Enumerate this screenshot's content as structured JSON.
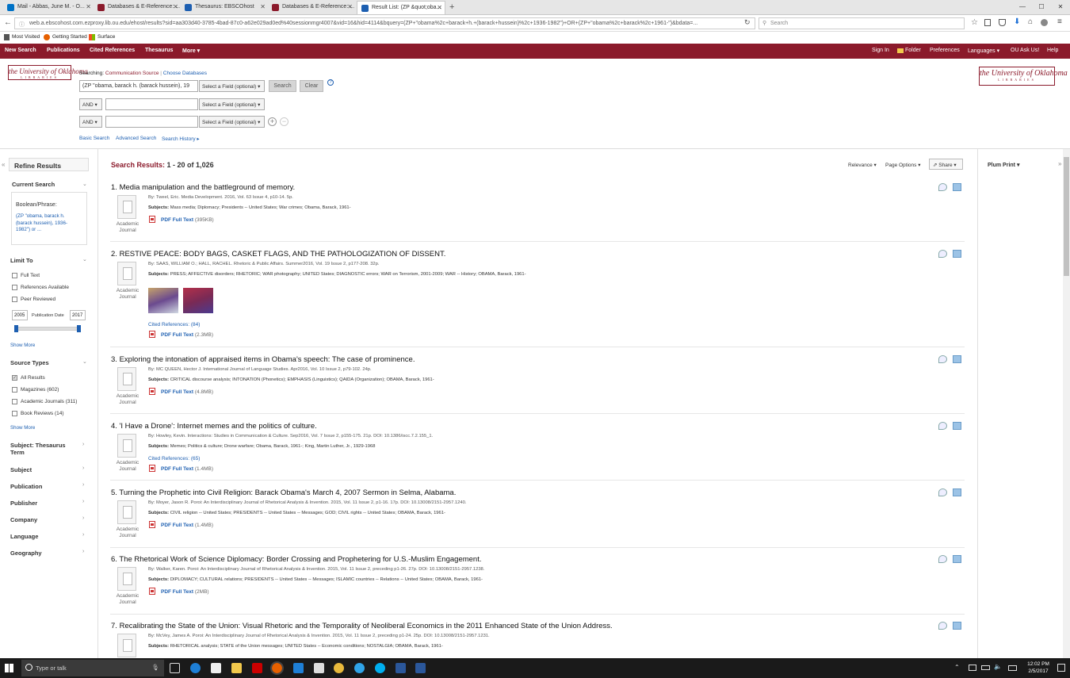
{
  "browser": {
    "tabs": [
      {
        "label": "Mail - Abbas, June M. - O...",
        "color": "#0072c6"
      },
      {
        "label": "Databases & E-Reference: ...",
        "color": "#8b1a2b"
      },
      {
        "label": "Thesaurus: EBSCOhost",
        "color": "#1d5fb1"
      },
      {
        "label": "Databases & E-Reference: ...",
        "color": "#8b1a2b"
      },
      {
        "label": "Result List: (ZP &quot;oba...",
        "color": "#1d5fb1"
      }
    ],
    "new_tab": "+",
    "url": "web.a.ebscohost.com.ezproxy.lib.ou.edu/ehost/results?sid=aa303d40-3785-4bad-87c0-a62e029ad0ed%40sessionmgr4007&vid=16&hid=4114&bquery=(ZP+\"obama%2c+barack+h.+(barack+hussein)%2c+1936-1982\")+OR+(ZP+\"obama%2c+barack%2c+1961-\")&bdata=...",
    "search_placeholder": "Search",
    "bookmarks": [
      "Most Visited",
      "Getting Started",
      "Surface"
    ]
  },
  "topnav": {
    "left": [
      "New Search",
      "Publications",
      "Cited References",
      "Thesaurus",
      "More ▾"
    ],
    "right": [
      "Sign In",
      "Folder",
      "Preferences",
      "Languages ▾",
      "OU Ask Us!",
      "Help"
    ]
  },
  "search": {
    "searching_label": "Searching:",
    "database": "Communication Source",
    "choose_db": "Choose Databases",
    "query1": "(ZP \"obama, barack h. (barack hussein), 19",
    "field_placeholder": "Select a Field (optional) ▾",
    "search_btn": "Search",
    "clear_btn": "Clear",
    "bool": "AND ▾",
    "links": [
      "Basic Search",
      "Advanced Search",
      "Search History ▸"
    ]
  },
  "logo": {
    "title": "the University of Oklahoma",
    "sub": "LIBRARIES"
  },
  "sidebar": {
    "refine": "Refine Results",
    "current_search": "Current Search",
    "boolean_label": "Boolean/Phrase:",
    "boolean_value": "(ZP \"obama, barack h. (barack hussein), 1936-1982\") or ...",
    "limit_to": "Limit To",
    "limits": [
      "Full Text",
      "References Available",
      "Peer Reviewed"
    ],
    "date_from": "2005",
    "date_label": "Publication Date",
    "date_to": "2017",
    "show_more": "Show More",
    "source_types": "Source Types",
    "sources": [
      "All Results",
      "Magazines (602)",
      "Academic Journals (311)",
      "Book Reviews (14)"
    ],
    "facets": [
      "Subject: Thesaurus Term",
      "Subject",
      "Publication",
      "Publisher",
      "Company",
      "Language",
      "Geography"
    ]
  },
  "results_header": {
    "label": "Search Results:",
    "range": "1 - 20 of 1,026",
    "relevance": "Relevance ▾",
    "page_options": "Page Options ▾",
    "share": "Share ▾"
  },
  "right": {
    "plum": "Plum Print ▾"
  },
  "results": [
    {
      "num": "1.",
      "title": "Media manipulation and the battleground of memory.",
      "meta": "By: Tweel, Eric. Media Development. 2016, Vol. 63 Issue 4, p10-14. 5p.",
      "subjects": "Mass media; Diplomacy; Presidents -- United States; War crimes; Obama, Barack, 1961-",
      "type": "Academic Journal",
      "cited": "",
      "pdf": "PDF Full Text",
      "size": "(395KB)",
      "images": false
    },
    {
      "num": "2.",
      "title": "RESTIVE PEACE: BODY BAGS, CASKET FLAGS, AND THE PATHOLOGIZATION OF DISSENT.",
      "meta": "By: SAAS, WILLIAM O.; HALL, RACHEL. Rhetoric & Public Affairs. Summer2016, Vol. 19 Issue 2, p177-208. 32p.",
      "subjects": "PRESS; AFFECTIVE disorders; RHETORIC; WAR photography; UNITED States; DIAGNOSTIC errors; WAR on Terrorism, 2001-2009; WAR -- History; OBAMA, Barack, 1961-",
      "type": "Academic Journal",
      "cited": "Cited References: (84)",
      "pdf": "PDF Full Text",
      "size": "(2.3MB)",
      "images": true
    },
    {
      "num": "3.",
      "title": "Exploring the intonation of appraised items in Obama's speech: The case of prominence.",
      "meta": "By: MC QUEEN, Hector J. International Journal of Language Studies. Apr2016, Vol. 10 Issue 2, p79-102. 24p.",
      "subjects": "CRITICAL discourse analysis; INTONATION (Phonetics); EMPHASIS (Linguistics); QAIDA (Organization); OBAMA, Barack, 1961-",
      "type": "Academic Journal",
      "cited": "",
      "pdf": "PDF Full Text",
      "size": "(4.8MB)",
      "images": false
    },
    {
      "num": "4.",
      "title": "'I Have a Drone': Internet memes and the politics of culture.",
      "meta": "By: Howley, Kevin. Interactions: Studies in Communication & Culture. Sep2016, Vol. 7 Issue 2, p155-175. 21p. DOI: 10.1386/iscc.7.2.155_1.",
      "subjects": "Memes; Politics & culture; Drone warfare; Obama, Barack, 1961-; King, Martin Luther, Jr., 1929-1968",
      "type": "Academic Journal",
      "cited": "Cited References: (65)",
      "pdf": "PDF Full Text",
      "size": "(1.4MB)",
      "images": false
    },
    {
      "num": "5.",
      "title": "Turning the Prophetic into Civil Religion: Barack Obama's March 4, 2007 Sermon in Selma, Alabama.",
      "meta": "By: Moyer, Jason R. Poroi: An Interdisciplinary Journal of Rhetorical Analysis & Invention. 2015, Vol. 11 Issue 2, p1-16. 17p. DOI: 10.13008/2151-2957.1240.",
      "subjects": "CIVIL religion -- United States; PRESIDENTS -- United States -- Messages; GOD; CIVIL rights -- United States; OBAMA, Barack, 1961-",
      "type": "Academic Journal",
      "cited": "",
      "pdf": "PDF Full Text",
      "size": "(1.4MB)",
      "images": false
    },
    {
      "num": "6.",
      "title": "The Rhetorical Work of Science Diplomacy: Border Crossing and Prophetering for U.S.-Muslim Engagement.",
      "meta": "By: Walker, Karen. Poroi: An Interdisciplinary Journal of Rhetorical Analysis & Invention. 2015, Vol. 11 Issue 2, preceding p1-26. 27p. DOI: 10.13008/2151-2957.1238.",
      "subjects": "DIPLOMACY; CULTURAL relations; PRESIDENTS -- United States -- Messages; ISLAMIC countries -- Relations -- United States; OBAMA, Barack, 1961-",
      "type": "Academic Journal",
      "cited": "",
      "pdf": "PDF Full Text",
      "size": "(2MB)",
      "images": false
    },
    {
      "num": "7.",
      "title": "Recalibrating the State of the Union: Visual Rhetoric and the Temporality of Neoliberal Economics in the 2011 Enhanced State of the Union Address.",
      "meta": "By: McVey, James A. Poroi: An Interdisciplinary Journal of Rhetorical Analysis & Invention. 2015, Vol. 11 Issue 2, preceding p1-24. 25p. DOI: 10.13008/2151-2957.1231.",
      "subjects": "RHETORICAL analysis; STATE of the Union messages; UNITED States -- Economic conditions; NOSTALGIA; OBAMA, Barack, 1961-",
      "type": "Academic Journal",
      "cited": "",
      "pdf": "",
      "size": "",
      "images": false
    }
  ],
  "subjects_label": "Subjects:",
  "taskbar": {
    "search_placeholder": "Type or talk",
    "time": "12:02 PM",
    "date": "2/5/2017"
  }
}
